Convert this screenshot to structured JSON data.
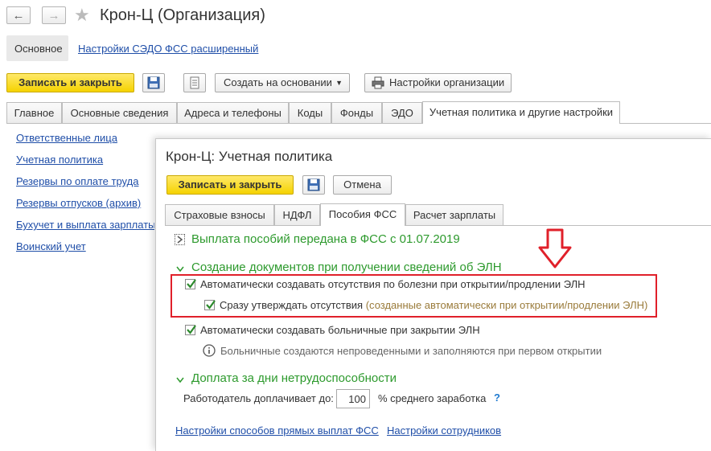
{
  "window": {
    "title": "Крон-Ц (Организация)"
  },
  "topnav": {
    "main_label": "Основное",
    "sedo_link": "Настройки СЭДО ФСС расширенный"
  },
  "toolbar": {
    "save_close": "Записать и закрыть",
    "create_based": "Создать на основании",
    "org_settings": "Настройки организации"
  },
  "tabs": [
    "Главное",
    "Основные сведения",
    "Адреса и телефоны",
    "Коды",
    "Фонды",
    "ЭДО",
    "Учетная политика и другие настройки"
  ],
  "sidebar": {
    "items": [
      "Ответственные лица",
      "Учетная политика",
      "Резервы по оплате труда",
      "Резервы отпусков (архив)",
      "Бухучет и выплата зарплаты",
      "Воинский учет"
    ]
  },
  "dialog": {
    "title": "Крон-Ц: Учетная политика",
    "save_close": "Записать и закрыть",
    "cancel": "Отмена",
    "tabs": [
      "Страховые взносы",
      "НДФЛ",
      "Пособия ФСС",
      "Расчет зарплаты"
    ],
    "section1": "Выплата пособий передана в ФСС с 01.07.2019",
    "section2": "Создание документов при получении сведений об ЭЛН",
    "chk_auto_absence": "Автоматически создавать отсутствия по болезни при открытии/продлении ЭЛН",
    "chk_approve": "Сразу утверждать отсутствия",
    "chk_approve_note": "(созданные автоматически при открытии/продлении ЭЛН)",
    "chk_auto_sick": "Автоматически создавать больничные при закрытии ЭЛН",
    "info_text": "Больничные создаются непроведенными и заполняются при первом открытии",
    "section3": "Доплата за дни нетрудоспособности",
    "employer_label": "Работодатель доплачивает до:",
    "employer_value": "100",
    "employer_suffix": "% среднего заработка",
    "help": "?",
    "link_payments": "Настройки способов прямых выплат ФСС",
    "link_employees": "Настройки сотрудников"
  },
  "colors": {
    "accent_yellow": "#f5d300",
    "section_green": "#2d9a2d",
    "link_blue": "#1f4ea8",
    "highlight_red": "#e0202a"
  }
}
